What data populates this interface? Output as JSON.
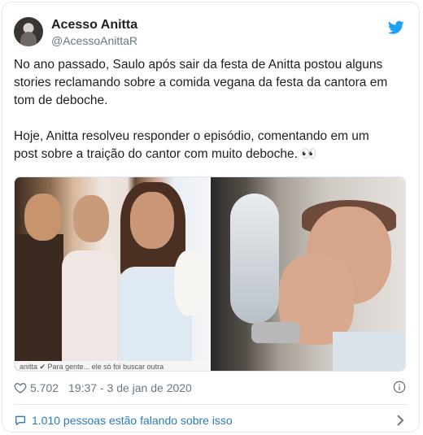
{
  "author": {
    "display_name": "Acesso Anitta",
    "handle": "@AcessoAnittaR"
  },
  "tweet": {
    "paragraph_1": "No ano passado, Saulo após sair da festa de Anitta postou alguns stories reclamando sobre a comida vegana da festa da cantora em tom de deboche.",
    "paragraph_2": "Hoje, Anitta resolveu responder o episódio, comentando em um post sobre a traição do cantor com muito deboche. 👀"
  },
  "media": {
    "left_caption": "anitta ✔ Para gente... ele só foi buscar outra"
  },
  "meta": {
    "likes": "5.702",
    "timestamp": "19:37 - 3 de jan de 2020"
  },
  "conversation": {
    "label": "1.010 pessoas estão falando sobre isso"
  },
  "colors": {
    "twitter_blue": "#1da1f2",
    "link_blue": "#2b7bb9",
    "muted": "#697882"
  },
  "icons": [
    "twitter-bird-icon",
    "heart-icon",
    "info-icon",
    "reply-bubble-icon",
    "chevron-right-icon"
  ]
}
